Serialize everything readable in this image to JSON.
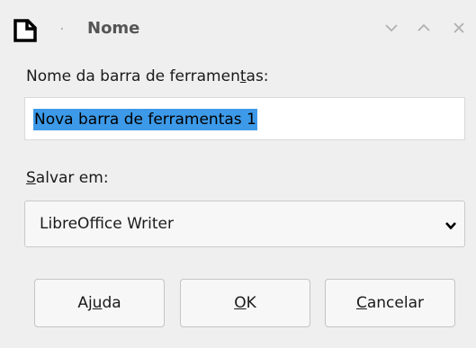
{
  "window": {
    "title": "Nome",
    "icon": "document-icon"
  },
  "dialog": {
    "name_label_pre": "Nome da barra de ferramen",
    "name_label_mnemonic": "t",
    "name_label_post": "as:",
    "name_value": "Nova barra de ferramentas 1",
    "save_label_mnemonic": "S",
    "save_label_post": "alvar em:",
    "save_selected": "LibreOffice Writer"
  },
  "buttons": {
    "help_pre": "Aj",
    "help_mnemonic": "u",
    "help_post": "da",
    "ok_mnemonic": "O",
    "ok_post": "K",
    "cancel_mnemonic": "C",
    "cancel_post": "ancelar"
  },
  "colors": {
    "selection": "#3d9ae9",
    "background": "#efefef"
  }
}
